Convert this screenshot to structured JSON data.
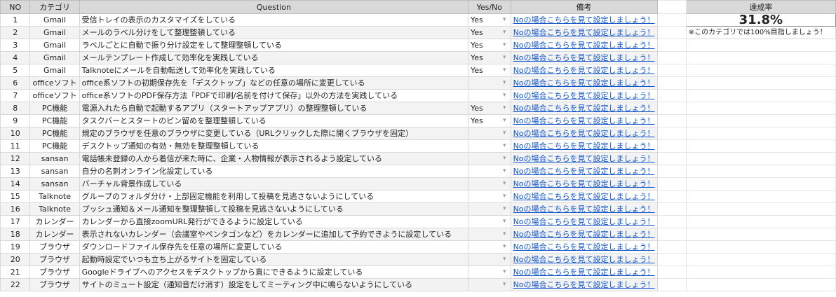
{
  "headers": {
    "no": "NO",
    "category": "カテゴリ",
    "question": "Question",
    "yesno": "Yes/No",
    "notes": "備考",
    "rate": "達成率"
  },
  "rate": {
    "value": "31.8%",
    "note": "※このカテゴリでは100%目指しましょう！"
  },
  "dropdown_icon": "chevron-down-icon",
  "link_color": "#1155cc",
  "rows": [
    {
      "no": "1",
      "category": "Gmail",
      "question": "受信トレイの表示のカスタマイズをしている",
      "answer": "Yes",
      "note": "Noの場合こちらを見て設定しましょう！"
    },
    {
      "no": "2",
      "category": "Gmail",
      "question": "メールのラベル分けをして整理整頓している",
      "answer": "Yes",
      "note": "Noの場合こちらを見て設定しましょう！"
    },
    {
      "no": "3",
      "category": "Gmail",
      "question": "ラベルごとに自動で振り分け設定をして整理整頓している",
      "answer": "Yes",
      "note": "Noの場合こちらを見て設定しましょう！"
    },
    {
      "no": "4",
      "category": "Gmail",
      "question": "メールテンプレート作成して効率化を実践している",
      "answer": "Yes",
      "note": "Noの場合こちらを見て設定しましょう！"
    },
    {
      "no": "5",
      "category": "Gmail",
      "question": "Talknoteにメールを自動転送して効率化を実践している",
      "answer": "Yes",
      "note": "Noの場合こちらを見て設定しましょう！"
    },
    {
      "no": "6",
      "category": "officeソフト",
      "question": "office系ソフトの初期保存先を「デスクトップ」などの任意の場所に変更している",
      "answer": "",
      "note": "Noの場合こちらを見て設定しましょう！"
    },
    {
      "no": "7",
      "category": "officeソフト",
      "question": "office系ソフトのPDF保存方法「PDFで印刷/名前を付けて保存」以外の方法を実践している",
      "answer": "",
      "note": "Noの場合こちらを見て設定しましょう！"
    },
    {
      "no": "8",
      "category": "PC機能",
      "question": "電源入れたら自動で起動するアプリ（スタートアップアプリ）の整理整頓している",
      "answer": "Yes",
      "note": "Noの場合こちらを見て設定しましょう！"
    },
    {
      "no": "9",
      "category": "PC機能",
      "question": "タスクバーとスタートのピン留めを整理整頓している",
      "answer": "Yes",
      "note": "Noの場合こちらを見て設定しましょう！"
    },
    {
      "no": "10",
      "category": "PC機能",
      "question": "規定のブラウザを任意のブラウザに変更している（URLクリックした際に開くブラウザを固定）",
      "answer": "",
      "note": "Noの場合こちらを見て設定しましょう！"
    },
    {
      "no": "11",
      "category": "PC機能",
      "question": "デスクトップ通知の有効・無効を整理整頓している",
      "answer": "",
      "note": "Noの場合こちらを見て設定しましょう！"
    },
    {
      "no": "12",
      "category": "sansan",
      "question": "電話帳未登録の人から着信が来た時に、企業・人物情報が表示されるよう設定している",
      "answer": "",
      "note": "Noの場合こちらを見て設定しましょう！"
    },
    {
      "no": "13",
      "category": "sansan",
      "question": "自分の名刺オンライン化設定している",
      "answer": "",
      "note": "Noの場合こちらを見て設定しましょう！"
    },
    {
      "no": "14",
      "category": "sansan",
      "question": "バーチャル背景作成している",
      "answer": "",
      "note": "Noの場合こちらを見て設定しましょう！"
    },
    {
      "no": "15",
      "category": "Talknote",
      "question": "グループのフォルダ分け・上部固定機能を利用して投稿を見逃さないようにしている",
      "answer": "",
      "note": "Noの場合こちらを見て設定しましょう！"
    },
    {
      "no": "16",
      "category": "Talknote",
      "question": "プッシュ通知＆メール通知を整理整頓して投稿を見逃さないようにしている",
      "answer": "",
      "note": "Noの場合こちらを見て設定しましょう！"
    },
    {
      "no": "17",
      "category": "カレンダー",
      "question": "カレンダーから直接zoomURL発行ができるように設定している",
      "answer": "",
      "note": "Noの場合こちらを見て設定しましょう！"
    },
    {
      "no": "18",
      "category": "カレンダー",
      "question": "表示されないカレンダー（会議室やペンタゴンなど）をカレンダーに追加して予約できように設定している",
      "answer": "",
      "note": "Noの場合こちらを見て設定しましょう！"
    },
    {
      "no": "19",
      "category": "ブラウザ",
      "question": "ダウンロードファイル保存先を任意の場所に変更している",
      "answer": "",
      "note": "Noの場合こちらを見て設定しましょう！"
    },
    {
      "no": "20",
      "category": "ブラウザ",
      "question": "起動時設定でいつも立ち上がるサイトを固定している",
      "answer": "",
      "note": "Noの場合こちらを見て設定しましょう！"
    },
    {
      "no": "21",
      "category": "ブラウザ",
      "question": "Googleドライブへのアクセスをデスクトップから直にできるように設定している",
      "answer": "",
      "note": "Noの場合こちらを見て設定しましょう！"
    },
    {
      "no": "22",
      "category": "ブラウザ",
      "question": "サイトのミュート設定（通知音だけ消す）設定をしてミーティング中に鳴らないようにしている",
      "answer": "",
      "note": "Noの場合こちらを見て設定しましょう！"
    }
  ]
}
